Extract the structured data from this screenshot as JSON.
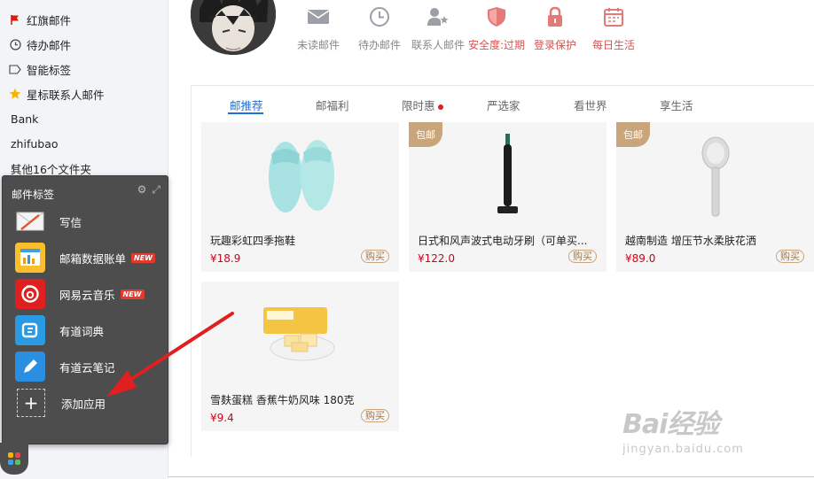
{
  "sidebar": {
    "items": [
      {
        "label": "红旗邮件",
        "icon": "red-flag-icon"
      },
      {
        "label": "待办邮件",
        "icon": "clock-icon"
      },
      {
        "label": "智能标签",
        "icon": "tag-icon"
      },
      {
        "label": "星标联系人邮件",
        "icon": "star-icon"
      },
      {
        "label": "Bank"
      },
      {
        "label": "zhifubao"
      },
      {
        "label": "其他16个文件夹"
      }
    ],
    "hidden_labels": [
      "邮件标签"
    ]
  },
  "app_panel": {
    "title": "邮件标签",
    "apps": [
      {
        "label": "写信",
        "icon": "write-letter-icon",
        "badge": ""
      },
      {
        "label": "邮箱数据账单",
        "icon": "data-bill-icon",
        "badge": "NEW"
      },
      {
        "label": "网易云音乐",
        "icon": "netease-music-icon",
        "badge": "NEW"
      },
      {
        "label": "有道词典",
        "icon": "youdao-dict-icon",
        "badge": ""
      },
      {
        "label": "有道云笔记",
        "icon": "youdao-note-icon",
        "badge": ""
      }
    ],
    "add_label": "添加应用",
    "add_symbol": "+"
  },
  "toolbar": {
    "items": [
      {
        "label": "未读邮件",
        "icon": "envelope-icon"
      },
      {
        "label": "待办邮件",
        "icon": "clock-icon"
      },
      {
        "label": "联系人邮件",
        "icon": "contact-star-icon"
      },
      {
        "label": "安全度:过期",
        "icon": "shield-icon"
      },
      {
        "label": "登录保护",
        "icon": "lock-icon"
      },
      {
        "label": "每日生活",
        "icon": "calendar-icon"
      }
    ]
  },
  "tabs": [
    {
      "label": "邮推荐"
    },
    {
      "label": "邮福利"
    },
    {
      "label": "限时惠"
    },
    {
      "label": "严选家"
    },
    {
      "label": "看世界"
    },
    {
      "label": "享生活"
    }
  ],
  "products": [
    {
      "name": "玩趣彩虹四季拖鞋",
      "price": "¥18.9",
      "buy": "购买",
      "tag": ""
    },
    {
      "name": "日式和风声波式电动牙刷（可单买...",
      "price": "¥122.0",
      "buy": "购买",
      "tag": "包邮"
    },
    {
      "name": "越南制造 增压节水柔肤花洒",
      "price": "¥89.0",
      "buy": "购买",
      "tag": "包邮"
    },
    {
      "name": "雪麸蛋糕 香蕉牛奶风味 180克",
      "price": "¥9.4",
      "buy": "购买",
      "tag": ""
    }
  ],
  "watermark": {
    "logo": "Bai经验",
    "sub": "jingyan.baidu.com"
  },
  "colors": {
    "accent": "#1e6fd9",
    "price": "#d0021b",
    "warning": "#d9534f",
    "panel": "#4d4d4d",
    "arrow": "#e02020"
  }
}
